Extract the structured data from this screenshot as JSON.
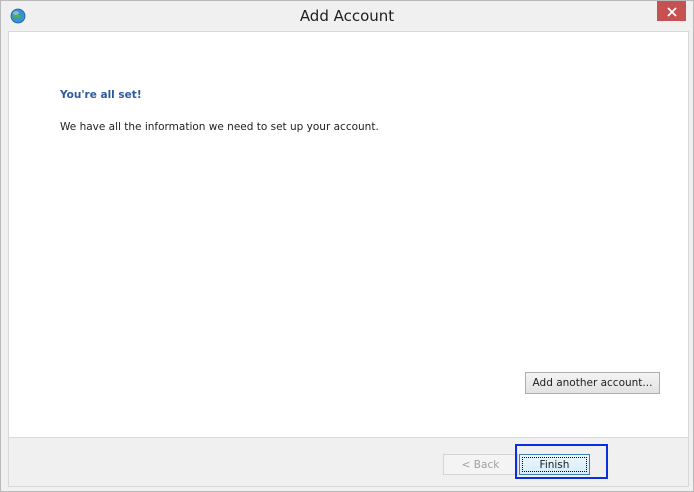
{
  "window": {
    "title": "Add Account",
    "icon": "globe-app-icon"
  },
  "content": {
    "heading": "You're all set!",
    "message": "We have all the information we need to set up your account.",
    "add_another_label": "Add another account..."
  },
  "footer": {
    "back_label": "< Back",
    "finish_label": "Finish"
  },
  "colors": {
    "heading": "#2c5aa0",
    "close_button": "#c75050",
    "focus_highlight": "#0a2ee0"
  }
}
